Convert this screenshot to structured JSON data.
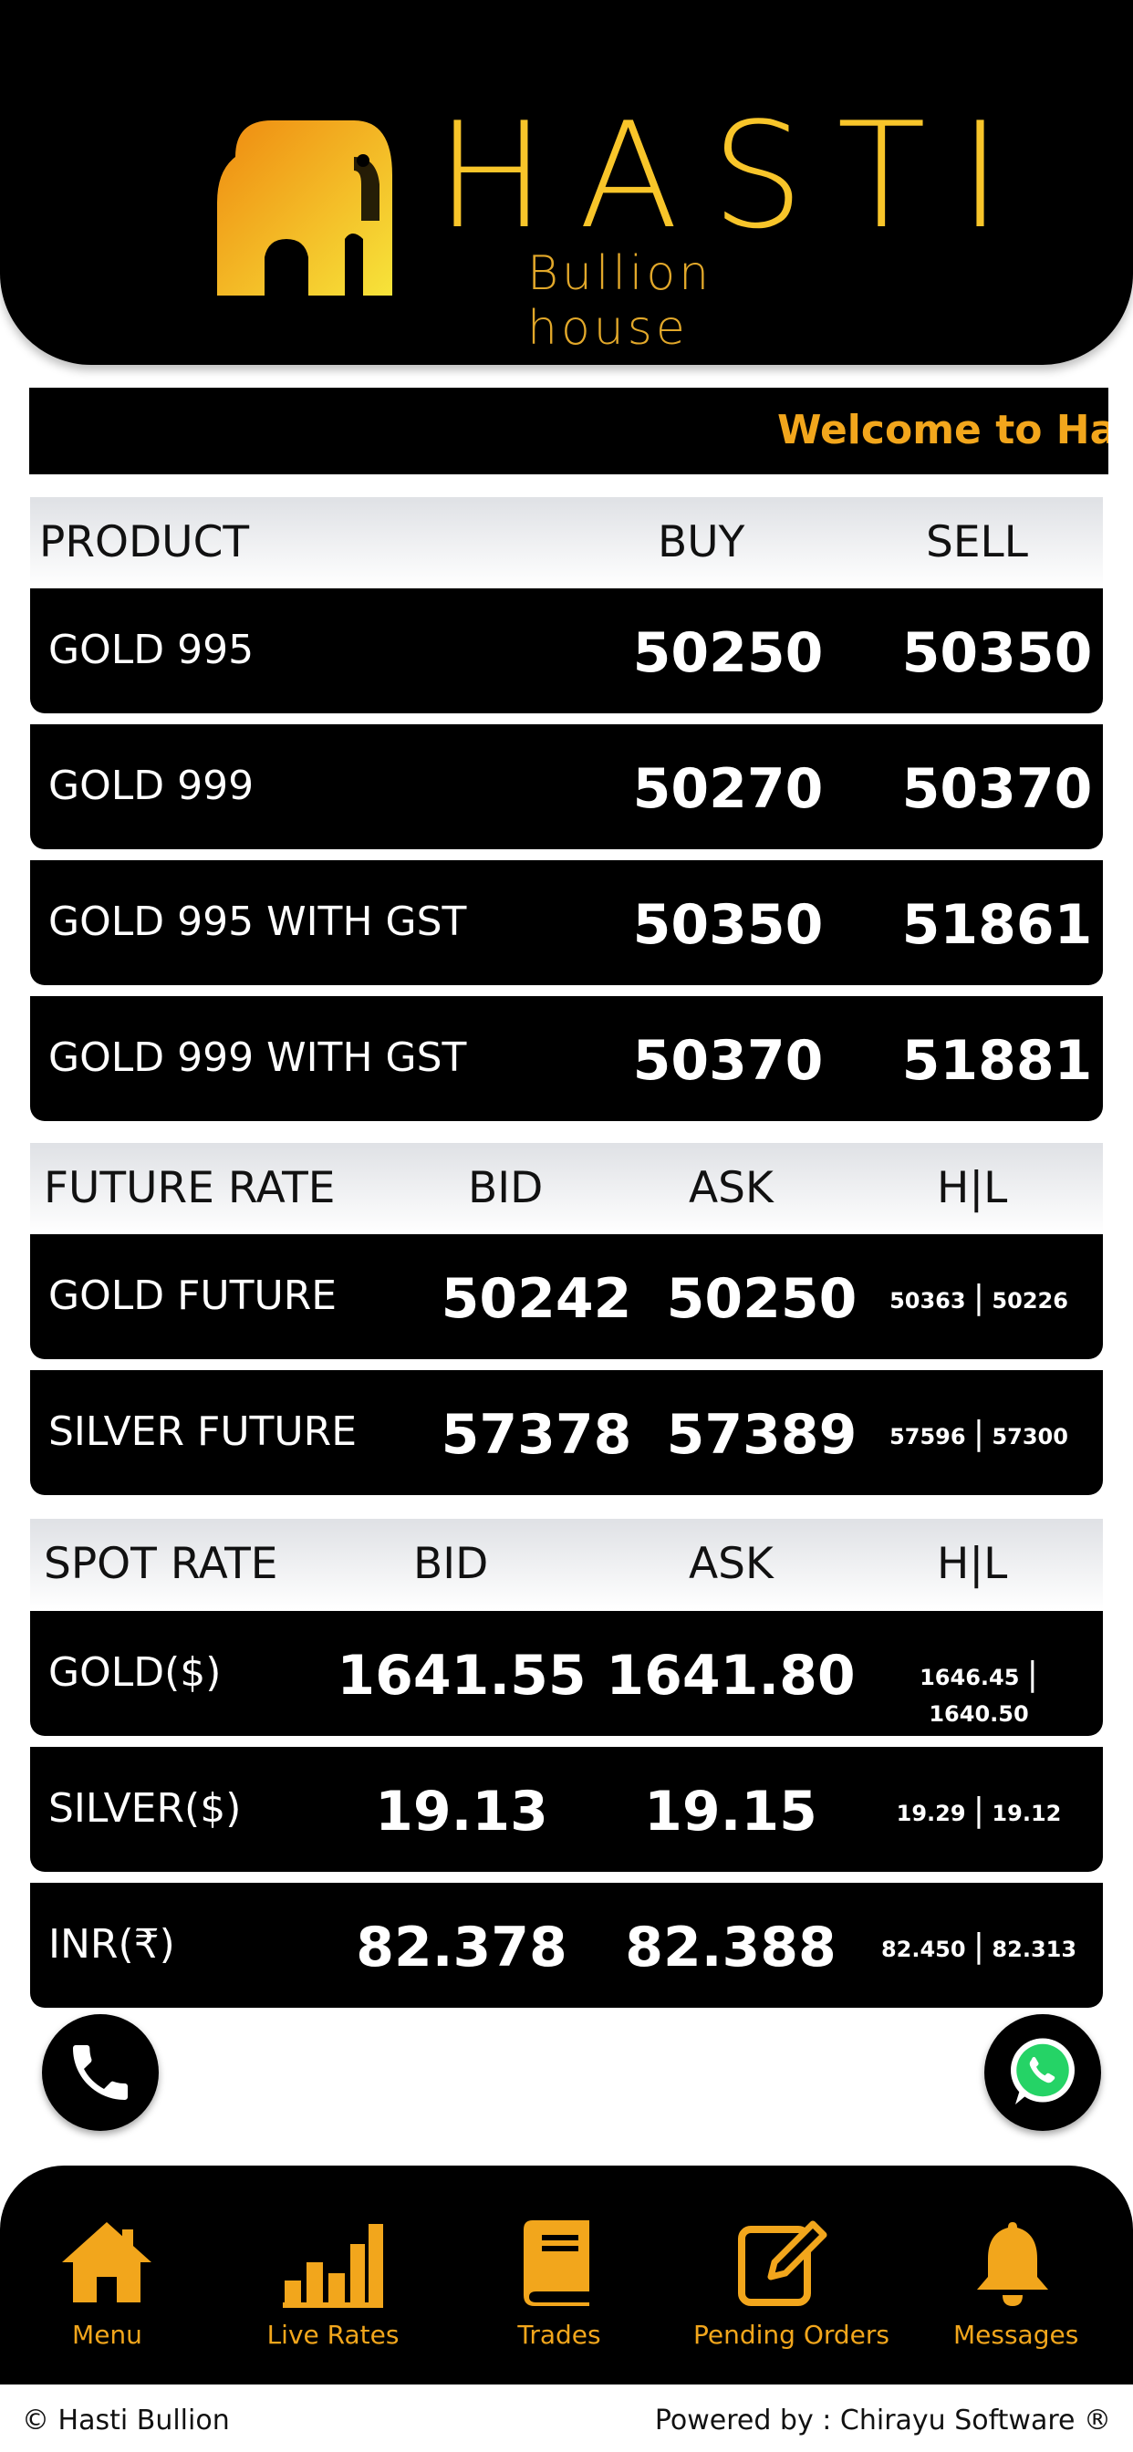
{
  "brand": {
    "title": "HASTI",
    "subtitle": "Bullion house"
  },
  "marquee": {
    "text": "Welcome to Hasti"
  },
  "products": {
    "headers": {
      "product": "PRODUCT",
      "buy": "BUY",
      "sell": "SELL"
    },
    "rows": [
      {
        "name": "GOLD 995",
        "buy": "50250",
        "sell": "50350"
      },
      {
        "name": "GOLD 999",
        "buy": "50270",
        "sell": "50370"
      },
      {
        "name": "GOLD 995 WITH GST",
        "buy": "50350",
        "sell": "51861"
      },
      {
        "name": "GOLD 999 WITH GST",
        "buy": "50370",
        "sell": "51881"
      }
    ]
  },
  "future": {
    "headers": {
      "title": "FUTURE RATE",
      "bid": "BID",
      "ask": "ASK",
      "hl": "H|L"
    },
    "rows": [
      {
        "name": "GOLD FUTURE",
        "bid": "50242",
        "ask": "50250",
        "high": "50363",
        "low": "50226"
      },
      {
        "name": "SILVER FUTURE",
        "bid": "57378",
        "ask": "57389",
        "high": "57596",
        "low": "57300"
      }
    ]
  },
  "spot": {
    "headers": {
      "title": "SPOT RATE",
      "bid": "BID",
      "ask": "ASK",
      "hl": "H|L"
    },
    "rows": [
      {
        "name": "GOLD($)",
        "bid": "1641.55",
        "ask": "1641.80",
        "high": "1646.45",
        "low": "1640.50"
      },
      {
        "name": "SILVER($)",
        "bid": "19.13",
        "ask": "19.15",
        "high": "19.29",
        "low": "19.12"
      },
      {
        "name": "INR(₹)",
        "bid": "82.378",
        "ask": "82.388",
        "high": "82.450",
        "low": "82.313"
      }
    ]
  },
  "hl_separator": "|",
  "fab": {
    "call_icon": "phone-icon",
    "whatsapp_icon": "whatsapp-icon"
  },
  "nav": {
    "items": [
      {
        "label": "Menu",
        "icon": "home-icon"
      },
      {
        "label": "Live Rates",
        "icon": "bar-chart-icon"
      },
      {
        "label": "Trades",
        "icon": "book-icon"
      },
      {
        "label": "Pending Orders",
        "icon": "edit-icon"
      },
      {
        "label": "Messages",
        "icon": "bell-icon"
      }
    ]
  },
  "footer": {
    "left": "© Hasti Bullion",
    "right": "Powered by : Chirayu Software ®"
  },
  "colors": {
    "accent": "#f2a61c",
    "logo_gold": "#f8c52a",
    "background": "#000000"
  }
}
